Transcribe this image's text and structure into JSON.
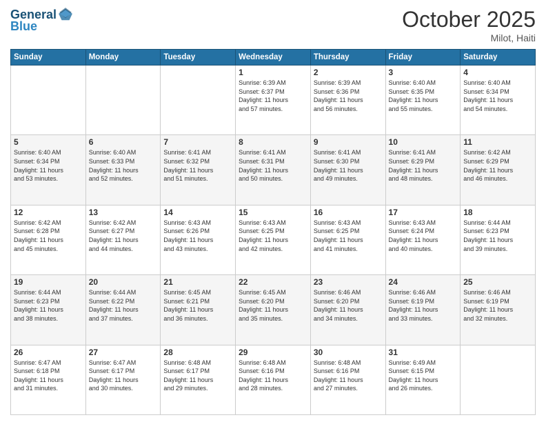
{
  "header": {
    "logo_line1": "General",
    "logo_line2": "Blue",
    "month": "October 2025",
    "location": "Milot, Haiti"
  },
  "days_of_week": [
    "Sunday",
    "Monday",
    "Tuesday",
    "Wednesday",
    "Thursday",
    "Friday",
    "Saturday"
  ],
  "weeks": [
    [
      {
        "day": "",
        "info": ""
      },
      {
        "day": "",
        "info": ""
      },
      {
        "day": "",
        "info": ""
      },
      {
        "day": "1",
        "info": "Sunrise: 6:39 AM\nSunset: 6:37 PM\nDaylight: 11 hours\nand 57 minutes."
      },
      {
        "day": "2",
        "info": "Sunrise: 6:39 AM\nSunset: 6:36 PM\nDaylight: 11 hours\nand 56 minutes."
      },
      {
        "day": "3",
        "info": "Sunrise: 6:40 AM\nSunset: 6:35 PM\nDaylight: 11 hours\nand 55 minutes."
      },
      {
        "day": "4",
        "info": "Sunrise: 6:40 AM\nSunset: 6:34 PM\nDaylight: 11 hours\nand 54 minutes."
      }
    ],
    [
      {
        "day": "5",
        "info": "Sunrise: 6:40 AM\nSunset: 6:34 PM\nDaylight: 11 hours\nand 53 minutes."
      },
      {
        "day": "6",
        "info": "Sunrise: 6:40 AM\nSunset: 6:33 PM\nDaylight: 11 hours\nand 52 minutes."
      },
      {
        "day": "7",
        "info": "Sunrise: 6:41 AM\nSunset: 6:32 PM\nDaylight: 11 hours\nand 51 minutes."
      },
      {
        "day": "8",
        "info": "Sunrise: 6:41 AM\nSunset: 6:31 PM\nDaylight: 11 hours\nand 50 minutes."
      },
      {
        "day": "9",
        "info": "Sunrise: 6:41 AM\nSunset: 6:30 PM\nDaylight: 11 hours\nand 49 minutes."
      },
      {
        "day": "10",
        "info": "Sunrise: 6:41 AM\nSunset: 6:29 PM\nDaylight: 11 hours\nand 48 minutes."
      },
      {
        "day": "11",
        "info": "Sunrise: 6:42 AM\nSunset: 6:29 PM\nDaylight: 11 hours\nand 46 minutes."
      }
    ],
    [
      {
        "day": "12",
        "info": "Sunrise: 6:42 AM\nSunset: 6:28 PM\nDaylight: 11 hours\nand 45 minutes."
      },
      {
        "day": "13",
        "info": "Sunrise: 6:42 AM\nSunset: 6:27 PM\nDaylight: 11 hours\nand 44 minutes."
      },
      {
        "day": "14",
        "info": "Sunrise: 6:43 AM\nSunset: 6:26 PM\nDaylight: 11 hours\nand 43 minutes."
      },
      {
        "day": "15",
        "info": "Sunrise: 6:43 AM\nSunset: 6:25 PM\nDaylight: 11 hours\nand 42 minutes."
      },
      {
        "day": "16",
        "info": "Sunrise: 6:43 AM\nSunset: 6:25 PM\nDaylight: 11 hours\nand 41 minutes."
      },
      {
        "day": "17",
        "info": "Sunrise: 6:43 AM\nSunset: 6:24 PM\nDaylight: 11 hours\nand 40 minutes."
      },
      {
        "day": "18",
        "info": "Sunrise: 6:44 AM\nSunset: 6:23 PM\nDaylight: 11 hours\nand 39 minutes."
      }
    ],
    [
      {
        "day": "19",
        "info": "Sunrise: 6:44 AM\nSunset: 6:23 PM\nDaylight: 11 hours\nand 38 minutes."
      },
      {
        "day": "20",
        "info": "Sunrise: 6:44 AM\nSunset: 6:22 PM\nDaylight: 11 hours\nand 37 minutes."
      },
      {
        "day": "21",
        "info": "Sunrise: 6:45 AM\nSunset: 6:21 PM\nDaylight: 11 hours\nand 36 minutes."
      },
      {
        "day": "22",
        "info": "Sunrise: 6:45 AM\nSunset: 6:20 PM\nDaylight: 11 hours\nand 35 minutes."
      },
      {
        "day": "23",
        "info": "Sunrise: 6:46 AM\nSunset: 6:20 PM\nDaylight: 11 hours\nand 34 minutes."
      },
      {
        "day": "24",
        "info": "Sunrise: 6:46 AM\nSunset: 6:19 PM\nDaylight: 11 hours\nand 33 minutes."
      },
      {
        "day": "25",
        "info": "Sunrise: 6:46 AM\nSunset: 6:19 PM\nDaylight: 11 hours\nand 32 minutes."
      }
    ],
    [
      {
        "day": "26",
        "info": "Sunrise: 6:47 AM\nSunset: 6:18 PM\nDaylight: 11 hours\nand 31 minutes."
      },
      {
        "day": "27",
        "info": "Sunrise: 6:47 AM\nSunset: 6:17 PM\nDaylight: 11 hours\nand 30 minutes."
      },
      {
        "day": "28",
        "info": "Sunrise: 6:48 AM\nSunset: 6:17 PM\nDaylight: 11 hours\nand 29 minutes."
      },
      {
        "day": "29",
        "info": "Sunrise: 6:48 AM\nSunset: 6:16 PM\nDaylight: 11 hours\nand 28 minutes."
      },
      {
        "day": "30",
        "info": "Sunrise: 6:48 AM\nSunset: 6:16 PM\nDaylight: 11 hours\nand 27 minutes."
      },
      {
        "day": "31",
        "info": "Sunrise: 6:49 AM\nSunset: 6:15 PM\nDaylight: 11 hours\nand 26 minutes."
      },
      {
        "day": "",
        "info": ""
      }
    ]
  ]
}
